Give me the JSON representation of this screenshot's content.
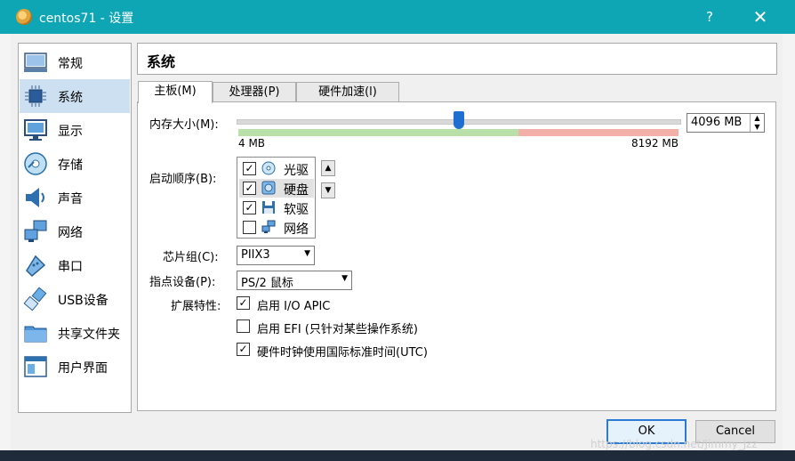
{
  "window": {
    "title": "centos71 - 设置",
    "help": "?",
    "close": "✕"
  },
  "sidebar": {
    "items": [
      {
        "label": "常规",
        "icon": "general-icon"
      },
      {
        "label": "系统",
        "icon": "system-chip-icon",
        "selected": true
      },
      {
        "label": "显示",
        "icon": "display-monitor-icon"
      },
      {
        "label": "存储",
        "icon": "storage-disk-icon"
      },
      {
        "label": "声音",
        "icon": "speaker-icon"
      },
      {
        "label": "网络",
        "icon": "network-icon"
      },
      {
        "label": "串口",
        "icon": "serial-port-icon"
      },
      {
        "label": "USB设备",
        "icon": "usb-icon"
      },
      {
        "label": "共享文件夹",
        "icon": "shared-folder-icon"
      },
      {
        "label": "用户界面",
        "icon": "user-interface-icon"
      }
    ]
  },
  "header": {
    "title": "系统"
  },
  "tabs": [
    {
      "label": "主板(M)",
      "active": true
    },
    {
      "label": "处理器(P)"
    },
    {
      "label": "硬件加速(l)"
    }
  ],
  "motherboard": {
    "memory_label": "内存大小(M):",
    "memory_value": "4096 MB",
    "memory_level_mb": 4096,
    "memory_min": "4 MB",
    "memory_max": "8192 MB",
    "boot_order_label": "启动顺序(B):",
    "boot_items": [
      {
        "label": "光驱",
        "checked": true,
        "icon": "optical-disc-icon"
      },
      {
        "label": "硬盘",
        "checked": true,
        "icon": "hard-disk-icon",
        "selected": true
      },
      {
        "label": "软驱",
        "checked": true,
        "icon": "floppy-icon"
      },
      {
        "label": "网络",
        "checked": false,
        "icon": "network-icon"
      }
    ],
    "chipset_label": "芯片组(C):",
    "chipset_value": "PIIX3",
    "pointing_label": "指点设备(P):",
    "pointing_value": "PS/2 鼠标",
    "extended_label": "扩展特性:",
    "features": [
      {
        "label": "启用 I/O APIC",
        "checked": true
      },
      {
        "label": "启用 EFI (只针对某些操作系统)",
        "checked": false
      },
      {
        "label": "硬件时钟使用国际标准时间(UTC)",
        "checked": true
      }
    ]
  },
  "footer": {
    "ok": "OK",
    "cancel": "Cancel",
    "watermark": "https://blog.csdn.net/Jimmy_jzz"
  }
}
